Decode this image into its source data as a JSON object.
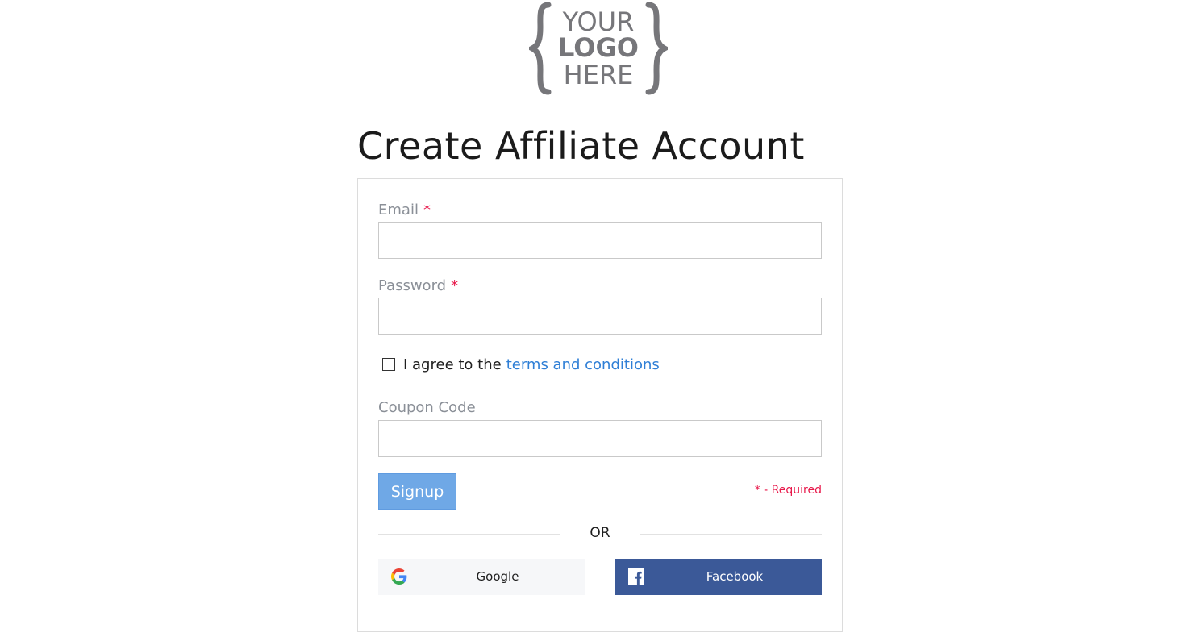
{
  "logo": {
    "line1": "YOUR",
    "line2": "LOGO",
    "line3": "HERE"
  },
  "page": {
    "title": "Create Affiliate Account"
  },
  "form": {
    "email": {
      "label": "Email",
      "required_mark": "*",
      "value": "",
      "placeholder": ""
    },
    "password": {
      "label": "Password",
      "required_mark": "*",
      "value": "",
      "placeholder": ""
    },
    "agree": {
      "checked": false,
      "text": "I agree to the",
      "link_text": "terms and conditions"
    },
    "coupon": {
      "label": "Coupon Code",
      "value": "",
      "placeholder": ""
    },
    "signup_label": "Signup",
    "required_note": "* - Required"
  },
  "divider": {
    "text": "OR"
  },
  "social": {
    "google": {
      "label": "Google",
      "icon": "google-icon"
    },
    "facebook": {
      "label": "Facebook",
      "icon": "facebook-icon"
    }
  },
  "colors": {
    "accent": "#6fa8e6",
    "link": "#2f7fd6",
    "required": "#e8184a",
    "facebook": "#3b5998",
    "label_gray": "#8a8f97"
  }
}
